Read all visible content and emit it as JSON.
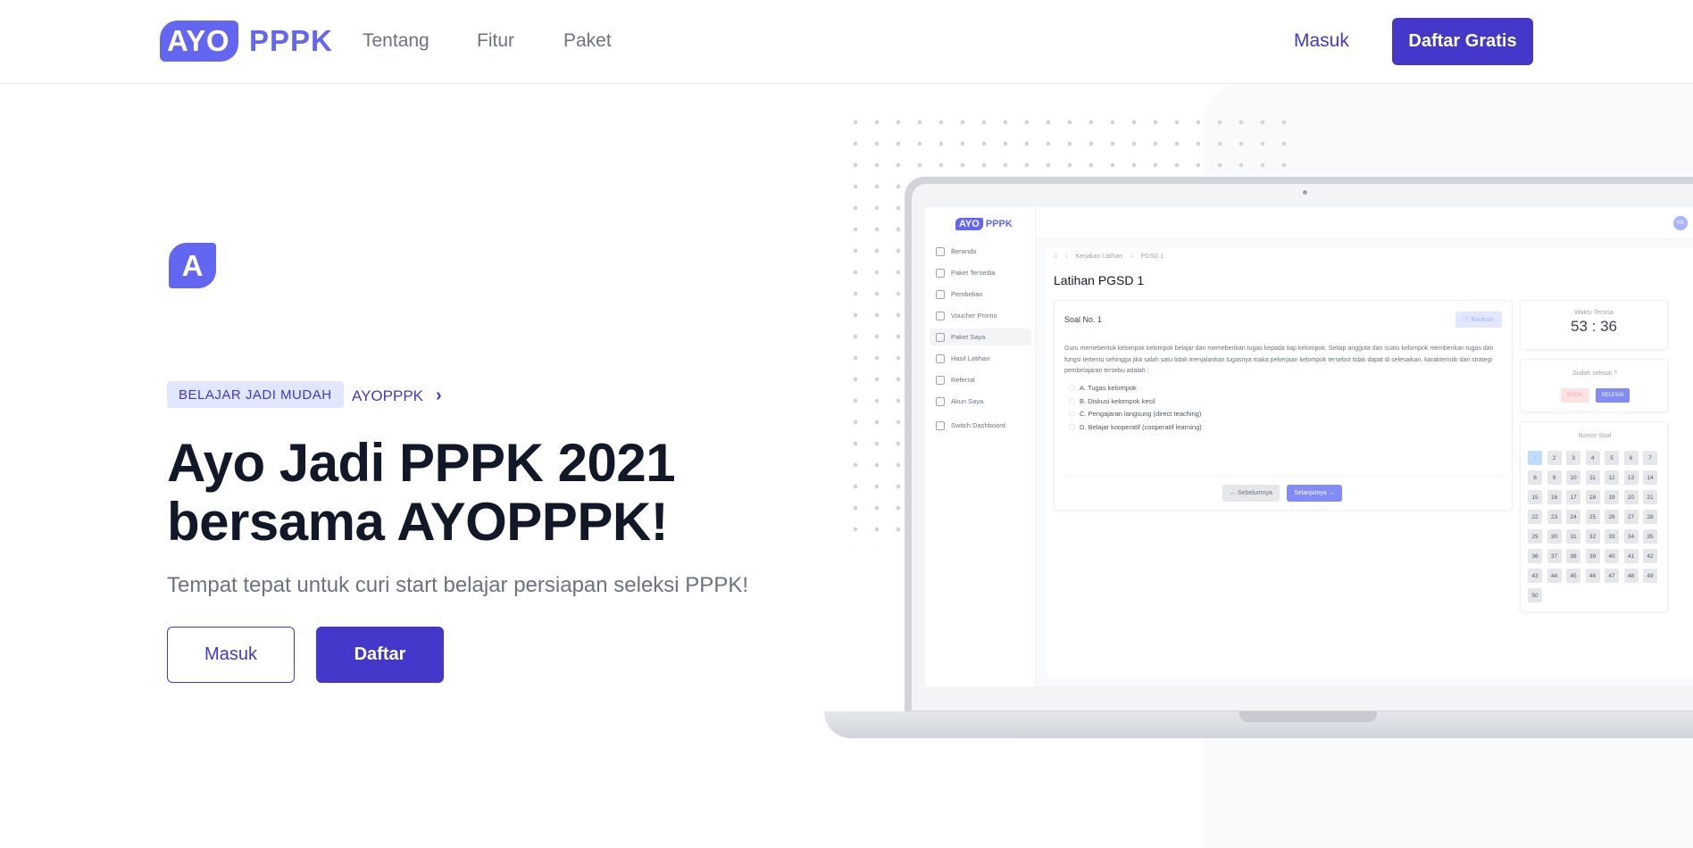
{
  "nav": {
    "logo_badge": "AYO",
    "logo_text": "PPPK",
    "links": [
      "Tentang",
      "Fitur",
      "Paket"
    ],
    "login": "Masuk",
    "signup": "Daftar Gratis"
  },
  "hero": {
    "icon_letter": "A",
    "pill": "BELAJAR JADI MUDAH",
    "pill_link": "AYOPPPK",
    "headline_line1": "Ayo Jadi PPPK 2021",
    "headline_line2": "bersama AYOPPPK!",
    "subtitle": "Tempat tepat untuk curi start belajar persiapan seleksi PPPK!",
    "btn_login": "Masuk",
    "btn_register": "Daftar"
  },
  "mockup": {
    "logo_badge": "AYO",
    "logo_text": "PPPK",
    "avatar": "KE",
    "sidebar": [
      "Beranda",
      "Paket Tersedia",
      "Pembelian",
      "Voucher Promo",
      "Paket Saya",
      "Hasil Latihan",
      "Referral",
      "Akun Saya",
      "Switch Dashboard"
    ],
    "active_item": "Paket Saya",
    "breadcrumb": [
      "Kerjakan Latihan",
      "PGSD 1"
    ],
    "title": "Latihan PGSD 1",
    "question_no": "Soal No. 1",
    "help": "Bantuan",
    "question": "Guru memebentuk kelompok kelompok belajar dan memeberikan tugas kepada tiap kelompok. Setiap anggota dan suatu kelompok memberikan tugas dan fungsi tertentu sehingga jika salah satu tidak menjalankan tugasnya maka pekerjaan kelompok tersebut tidak dapat di selesaikan. karakteristik dari strategi pembelajaran tersebu adalah :",
    "options": [
      "A. Tugas kelompok",
      "B. Diskusi kelompok kecil",
      "C. Pengajaran langsung (direct teaching)",
      "D. Belajar kooperatif (cooperatif learning)"
    ],
    "prev": "Sebelumnya",
    "next": "Selanjutnya",
    "timer_label": "Waktu Tersisa",
    "timer_value": "53 : 36",
    "done_label": "Sudah selesai ?",
    "cancel": "BATAL",
    "finish": "SELESAI",
    "number_label": "Nomor Soal",
    "numbers": [
      "1",
      "2",
      "3",
      "4",
      "5",
      "6",
      "7",
      "8",
      "9",
      "10",
      "11",
      "12",
      "13",
      "14",
      "15",
      "16",
      "17",
      "18",
      "19",
      "20",
      "21",
      "22",
      "23",
      "24",
      "25",
      "26",
      "27",
      "28",
      "29",
      "30",
      "31",
      "32",
      "33",
      "34",
      "35",
      "36",
      "37",
      "38",
      "39",
      "40",
      "41",
      "42",
      "43",
      "44",
      "45",
      "46",
      "47",
      "48",
      "49",
      "50"
    ],
    "current_number": "1"
  },
  "colors": {
    "primary": "#4338ca",
    "logo": "#6366f1",
    "pill_bg": "#e0e7ff"
  }
}
